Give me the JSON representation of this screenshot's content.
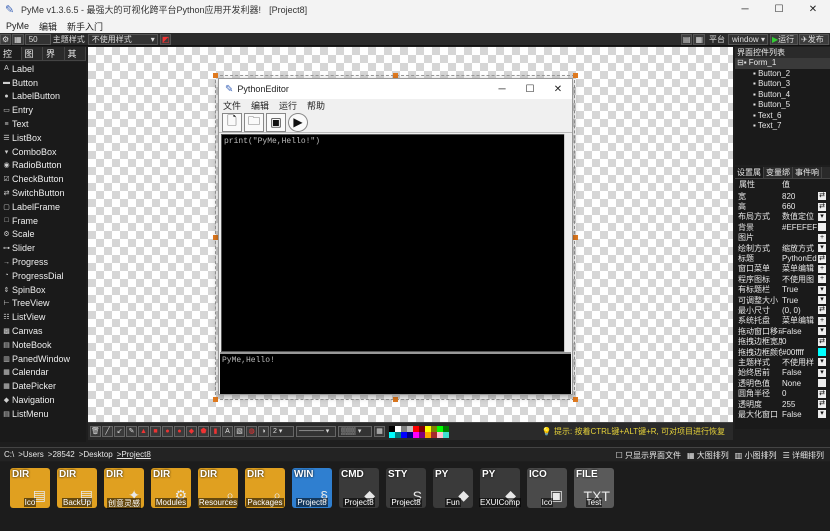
{
  "window": {
    "title": "PyMe v1.3.6.5 - 最强大的可视化跨平台Python应用开发利器!",
    "project": "[Project8]",
    "minimize": "─",
    "maximize": "☐",
    "close": "✕"
  },
  "menubar": [
    "PyMe",
    "编辑",
    "新手入门"
  ],
  "toolbar": {
    "size_value": "50",
    "theme_label": "主题样式",
    "style_value": "不使用样式",
    "platform_label": "平台",
    "platform_value": "window",
    "run_label": "运行",
    "publish_label": "发布"
  },
  "left_tabs": [
    "控件",
    "图表",
    "界面",
    "其它"
  ],
  "palette": [
    {
      "icon": "A",
      "label": "Label"
    },
    {
      "icon": "▬",
      "label": "Button"
    },
    {
      "icon": "●",
      "label": "LabelButton"
    },
    {
      "icon": "▭",
      "label": "Entry"
    },
    {
      "icon": "≡",
      "label": "Text"
    },
    {
      "icon": "☰",
      "label": "ListBox"
    },
    {
      "icon": "▾",
      "label": "ComboBox"
    },
    {
      "icon": "◉",
      "label": "RadioButton"
    },
    {
      "icon": "☑",
      "label": "CheckButton"
    },
    {
      "icon": "⇄",
      "label": "SwitchButton"
    },
    {
      "icon": "▢",
      "label": "LabelFrame"
    },
    {
      "icon": "□",
      "label": "Frame"
    },
    {
      "icon": "⚙",
      "label": "Scale"
    },
    {
      "icon": "⊶",
      "label": "Slider"
    },
    {
      "icon": "→",
      "label": "Progress"
    },
    {
      "icon": "◔",
      "label": "ProgressDial"
    },
    {
      "icon": "⇕",
      "label": "SpinBox"
    },
    {
      "icon": "⊢",
      "label": "TreeView"
    },
    {
      "icon": "☷",
      "label": "ListView"
    },
    {
      "icon": "▩",
      "label": "Canvas"
    },
    {
      "icon": "▤",
      "label": "NoteBook"
    },
    {
      "icon": "▥",
      "label": "PanedWindow"
    },
    {
      "icon": "▦",
      "label": "Calendar"
    },
    {
      "icon": "▦",
      "label": "DatePicker"
    },
    {
      "icon": "◆",
      "label": "Navigation"
    },
    {
      "icon": "▤",
      "label": "ListMenu"
    }
  ],
  "editor": {
    "title": "PythonEditor",
    "menu": [
      "文件",
      "编辑",
      "运行",
      "帮助"
    ],
    "tool_icons": [
      "new-file-icon",
      "open-folder-icon",
      "save-icon",
      "play-icon"
    ],
    "code": "print(\"PyMe,Hello!\")",
    "output": "PyMe,Hello!"
  },
  "drawbar": {
    "line_width": "2",
    "tip": "提示: 按着CTRL键+ALT键+R, 可对项目进行恢复"
  },
  "swatches": [
    "#000000",
    "#ffffff",
    "#808080",
    "#c0c0c0",
    "#ff0000",
    "#800000",
    "#ffff00",
    "#808000",
    "#00ff00",
    "#008000",
    "#00ffff",
    "#008080",
    "#0000ff",
    "#000080",
    "#ff00ff",
    "#800080",
    "#ffa500",
    "#a52a2a",
    "#ffc0cb",
    "#40e0d0"
  ],
  "tree": {
    "title": "界面控件列表",
    "items": [
      "Form_1",
      "Button_2",
      "Button_3",
      "Button_4",
      "Button_5",
      "Text_6",
      "Text_7"
    ]
  },
  "prop_tabs": [
    "设置属",
    "变量绑",
    "事件响"
  ],
  "props_header": {
    "key": "属性",
    "value": "值"
  },
  "props": [
    {
      "k": "宽",
      "v": "820",
      "b": "⇄"
    },
    {
      "k": "高",
      "v": "660",
      "b": "⇄"
    },
    {
      "k": "布局方式",
      "v": "数值定位",
      "b": "▾"
    },
    {
      "k": "背景",
      "v": "#EFEFEF",
      "b": ""
    },
    {
      "k": "图片",
      "v": "",
      "b": "+"
    },
    {
      "k": "绘制方式",
      "v": "缩放方式",
      "b": "▾"
    },
    {
      "k": "标题",
      "v": "PythonEd",
      "b": "⇄"
    },
    {
      "k": "窗口菜单",
      "v": "菜单编辑",
      "b": "+"
    },
    {
      "k": "程序图标",
      "v": "不使用图",
      "b": "+"
    },
    {
      "k": "有标题栏",
      "v": "True",
      "b": "▾"
    },
    {
      "k": "可调整大小",
      "v": "True",
      "b": "▾"
    },
    {
      "k": "最小尺寸",
      "v": "(0, 0)",
      "b": "⇄"
    },
    {
      "k": "系统托盘",
      "v": "菜单编辑",
      "b": "+"
    },
    {
      "k": "拖动窗口移动",
      "v": "False",
      "b": "▾"
    },
    {
      "k": "拖拽边框宽度",
      "v": "0",
      "b": "⇄"
    },
    {
      "k": "拖拽边框颜色",
      "v": "#00ffff",
      "b": ""
    },
    {
      "k": "主题样式",
      "v": "不使用样",
      "b": "▾"
    },
    {
      "k": "始终居前",
      "v": "False",
      "b": "▾"
    },
    {
      "k": "透明色值",
      "v": "None",
      "b": ""
    },
    {
      "k": "圆角半径",
      "v": "0",
      "b": "⇄"
    },
    {
      "k": "透明度",
      "v": "255",
      "b": "⇄"
    },
    {
      "k": "最大化窗口",
      "v": "False",
      "b": "▾"
    }
  ],
  "path": {
    "crumbs": [
      "C:\\",
      ">Users",
      ">28542",
      ">Desktop",
      ">Project8"
    ],
    "only_ui": "只显示界面文件",
    "view_large": "大图排列",
    "view_small": "小图排列",
    "view_detail": "详细排列"
  },
  "files": [
    {
      "tag": "DIR",
      "label": "Ico",
      "color": "#e0a020",
      "glyph": "▤"
    },
    {
      "tag": "DIR",
      "label": "BackUp",
      "color": "#e0a020",
      "glyph": "▤"
    },
    {
      "tag": "DIR",
      "label": "创意灵感",
      "color": "#e0a020",
      "glyph": "✦"
    },
    {
      "tag": "DIR",
      "label": "Modules",
      "color": "#e0a020",
      "glyph": "⚙"
    },
    {
      "tag": "DIR",
      "label": "Resources",
      "color": "#e0a020",
      "glyph": "⌕"
    },
    {
      "tag": "DIR",
      "label": "Packages",
      "color": "#e0a020",
      "glyph": "⌕"
    },
    {
      "tag": "WIN",
      "label": "Project8",
      "color": "#2f7fd0",
      "glyph": "§"
    },
    {
      "tag": "CMD",
      "label": "Project8",
      "color": "#3a3a3a",
      "glyph": "◆"
    },
    {
      "tag": "STY",
      "label": "Project8",
      "color": "#3a3a3a",
      "glyph": "S"
    },
    {
      "tag": "PY",
      "label": "Fun",
      "color": "#3a3a3a",
      "glyph": "◆"
    },
    {
      "tag": "PY",
      "label": "EXUIComp",
      "color": "#3a3a3a",
      "glyph": "◆"
    },
    {
      "tag": "ICO",
      "label": "Ico",
      "color": "#4a4a4a",
      "glyph": "▣"
    },
    {
      "tag": "FILE",
      "label": "Test",
      "color": "#5a5a5a",
      "glyph": "TXT"
    }
  ]
}
